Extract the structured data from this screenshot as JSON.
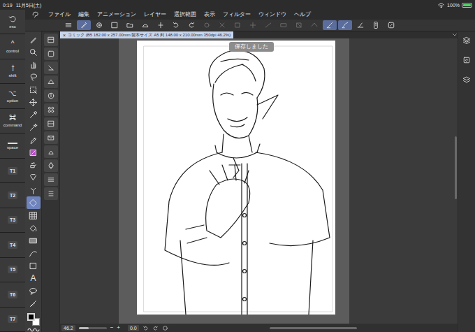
{
  "status_bar": {
    "time": "0:19",
    "date": "11月5日(土)",
    "battery": "100%",
    "charging": true
  },
  "modifier_keys": [
    {
      "label": "esc",
      "kind": "icon"
    },
    {
      "label": "control",
      "kind": "glyph",
      "glyph": "^"
    },
    {
      "label": "shift",
      "kind": "glyph",
      "glyph": "⇧"
    },
    {
      "label": "option",
      "kind": "glyph",
      "glyph": "⌥"
    },
    {
      "label": "command",
      "kind": "glyph",
      "glyph": "⌘"
    },
    {
      "label": "space",
      "kind": "bar"
    },
    {
      "label": "T1",
      "kind": "label"
    },
    {
      "label": "T2",
      "kind": "label"
    },
    {
      "label": "T3",
      "kind": "label"
    },
    {
      "label": "T4",
      "kind": "label"
    },
    {
      "label": "T5",
      "kind": "label"
    },
    {
      "label": "T6",
      "kind": "label"
    },
    {
      "label": "T7",
      "kind": "label"
    }
  ],
  "menu": [
    "ファイル",
    "編集",
    "アニメーション",
    "レイヤー",
    "選択範囲",
    "表示",
    "フィルター",
    "ウィンドウ",
    "ヘルプ"
  ],
  "commands": [
    {
      "selected": false,
      "disabled": false
    },
    {
      "selected": true,
      "disabled": false
    },
    {
      "selected": false,
      "disabled": false
    },
    {
      "selected": false,
      "disabled": false
    },
    {
      "selected": false,
      "disabled": false
    },
    {
      "selected": false,
      "disabled": false
    },
    {
      "selected": false,
      "disabled": false
    },
    {
      "selected": false,
      "disabled": false
    },
    {
      "selected": false,
      "disabled": false
    },
    {
      "selected": false,
      "disabled": true
    },
    {
      "selected": false,
      "disabled": true
    },
    {
      "selected": false,
      "disabled": true
    },
    {
      "selected": false,
      "disabled": true
    },
    {
      "selected": false,
      "disabled": true
    },
    {
      "selected": false,
      "disabled": true
    },
    {
      "selected": false,
      "disabled": true
    },
    {
      "selected": false,
      "disabled": true
    },
    {
      "selected": true,
      "disabled": false
    },
    {
      "selected": true,
      "disabled": false
    },
    {
      "selected": false,
      "disabled": false
    },
    {
      "selected": false,
      "disabled": false
    },
    {
      "selected": false,
      "disabled": false
    }
  ],
  "tab": {
    "close": "×",
    "label": "コミック (B5 182.00 x 257.00mm 製本サイズ A5 判 148.00 x 210.00mm 350dpi 46.2%)",
    "selected": true
  },
  "toast": "保存しました",
  "tools": [
    {
      "selected": false
    },
    {
      "selected": false
    },
    {
      "selected": false
    },
    {
      "selected": false
    },
    {
      "selected": false
    },
    {
      "selected": false
    },
    {
      "selected": false
    },
    {
      "selected": false
    },
    {
      "selected": false
    },
    {
      "selected": false
    },
    {
      "selected": false
    },
    {
      "selected": false
    },
    {
      "selected": false
    },
    {
      "selected": true
    },
    {
      "selected": false
    },
    {
      "selected": false
    },
    {
      "selected": false
    },
    {
      "selected": false
    },
    {
      "selected": false
    },
    {
      "selected": false,
      "glyph": "A"
    },
    {
      "selected": false
    },
    {
      "selected": false
    }
  ],
  "sub_tools": [
    {
      "selected": false
    },
    {
      "selected": false
    },
    {
      "selected": false
    },
    {
      "selected": false
    },
    {
      "selected": false
    },
    {
      "selected": false
    },
    {
      "selected": false
    },
    {
      "selected": false
    },
    {
      "selected": false
    },
    {
      "selected": false
    },
    {
      "selected": false
    },
    {
      "selected": false
    }
  ],
  "color_swatches": [
    {
      "color": "#000000",
      "selected": true
    },
    {
      "color": "#ffffff",
      "selected": false
    }
  ],
  "right_panel": [
    {
      "selected": false
    },
    {
      "selected": false
    },
    {
      "selected": false
    }
  ],
  "bottom_bar": {
    "zoom": "46.2",
    "zoom_slider": {
      "level": 0.35
    },
    "zoom_out": "−",
    "zoom_in": "+",
    "rotation": "0.0"
  }
}
